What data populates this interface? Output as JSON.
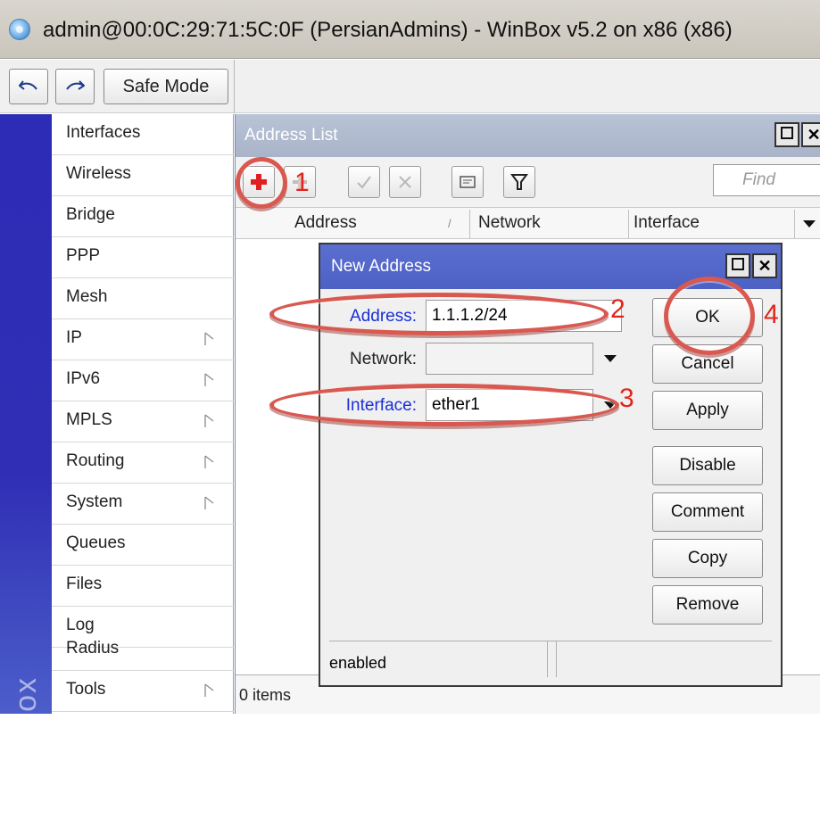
{
  "window": {
    "title": "admin@00:0C:29:71:5C:0F (PersianAdmins) - WinBox v5.2 on x86 (x86)",
    "icon": "winbox-app-icon"
  },
  "toolbar": {
    "undo_icon": "undo-icon",
    "redo_icon": "redo-icon",
    "safe_mode_label": "Safe Mode"
  },
  "sidebar": {
    "brand": "nBox",
    "items": [
      {
        "label": "Interfaces",
        "submenu": false
      },
      {
        "label": "Wireless",
        "submenu": false
      },
      {
        "label": "Bridge",
        "submenu": false
      },
      {
        "label": "PPP",
        "submenu": false
      },
      {
        "label": "Mesh",
        "submenu": false
      },
      {
        "label": "IP",
        "submenu": true
      },
      {
        "label": "IPv6",
        "submenu": true
      },
      {
        "label": "MPLS",
        "submenu": true
      },
      {
        "label": "Routing",
        "submenu": true
      },
      {
        "label": "System",
        "submenu": true
      },
      {
        "label": "Queues",
        "submenu": false
      },
      {
        "label": "Files",
        "submenu": false
      },
      {
        "label": "Log",
        "submenu": false
      },
      {
        "label": "Radius",
        "submenu": false
      },
      {
        "label": "Tools",
        "submenu": true
      }
    ]
  },
  "address_list": {
    "title": "Address List",
    "find_placeholder": "Find",
    "columns": [
      "Address",
      "Network",
      "Interface"
    ],
    "status": "0 items"
  },
  "new_address": {
    "title": "New Address",
    "fields": {
      "address_label": "Address:",
      "address_value": "1.1.1.2/24",
      "network_label": "Network:",
      "network_value": "",
      "interface_label": "Interface:",
      "interface_value": "ether1"
    },
    "buttons": {
      "ok": "OK",
      "cancel": "Cancel",
      "apply": "Apply",
      "disable": "Disable",
      "comment": "Comment",
      "copy": "Copy",
      "remove": "Remove"
    },
    "status": "enabled"
  },
  "annotations": {
    "n1": "1",
    "n2": "2",
    "n3": "3",
    "n4": "4"
  },
  "colors": {
    "sidebar_blue": "#2f2eb5",
    "dialog_title": "#5468c9",
    "callout_red": "#d9584f",
    "field_label_blue": "#1a2fd8"
  }
}
